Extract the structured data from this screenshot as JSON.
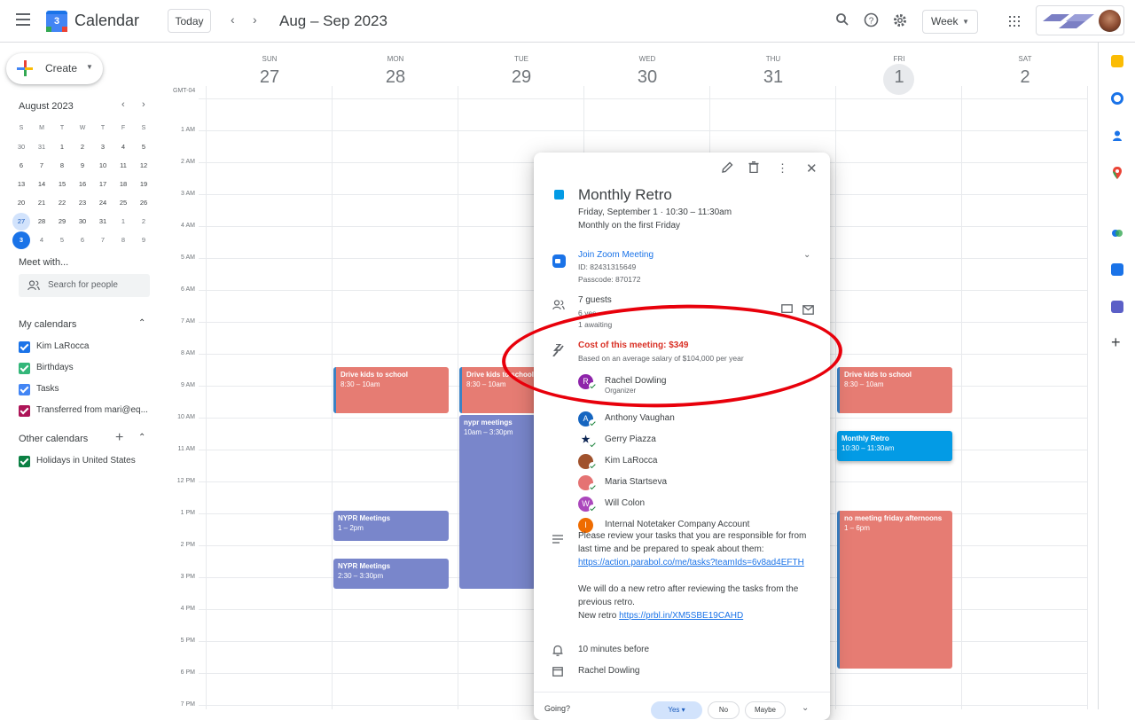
{
  "header": {
    "logo_day": "3",
    "app_title": "Calendar",
    "today_label": "Today",
    "date_range": "Aug – Sep 2023",
    "view_label": "Week"
  },
  "sidebar": {
    "create_label": "Create",
    "mini_month_title": "August 2023",
    "mini_dow": [
      "S",
      "M",
      "T",
      "W",
      "T",
      "F",
      "S"
    ],
    "mini_weeks": [
      [
        "30",
        "31",
        "1",
        "2",
        "3",
        "4",
        "5"
      ],
      [
        "6",
        "7",
        "8",
        "9",
        "10",
        "11",
        "12"
      ],
      [
        "13",
        "14",
        "15",
        "16",
        "17",
        "18",
        "19"
      ],
      [
        "20",
        "21",
        "22",
        "23",
        "24",
        "25",
        "26"
      ],
      [
        "27",
        "28",
        "29",
        "30",
        "31",
        "1",
        "2"
      ],
      [
        "3",
        "4",
        "5",
        "6",
        "7",
        "8",
        "9"
      ]
    ],
    "meet_with": "Meet with...",
    "search_people_placeholder": "Search for people",
    "my_calendars_title": "My calendars",
    "my_calendars": [
      {
        "label": "Kim LaRocca",
        "color": "#1a73e8"
      },
      {
        "label": "Birthdays",
        "color": "#33b679"
      },
      {
        "label": "Tasks",
        "color": "#4285f4"
      },
      {
        "label": "Transferred from mari@eq...",
        "color": "#ad1457"
      }
    ],
    "other_calendars_title": "Other calendars",
    "other_calendars": [
      {
        "label": "Holidays in United States",
        "color": "#0b8043"
      }
    ]
  },
  "calendar": {
    "timezone": "GMT-04",
    "days": [
      {
        "dow": "SUN",
        "num": "27"
      },
      {
        "dow": "MON",
        "num": "28"
      },
      {
        "dow": "TUE",
        "num": "29"
      },
      {
        "dow": "WED",
        "num": "30"
      },
      {
        "dow": "THU",
        "num": "31"
      },
      {
        "dow": "FRI",
        "num": "1"
      },
      {
        "dow": "SAT",
        "num": "2"
      }
    ],
    "hours": [
      "1 AM",
      "2 AM",
      "3 AM",
      "4 AM",
      "5 AM",
      "6 AM",
      "7 AM",
      "8 AM",
      "9 AM",
      "10 AM",
      "11 AM",
      "12 PM",
      "1 PM",
      "2 PM",
      "3 PM",
      "4 PM",
      "5 PM",
      "6 PM",
      "7 PM"
    ],
    "events": [
      {
        "title": "Drive kids to school",
        "time": "8:30 – 10am",
        "day": 1
      },
      {
        "title": "Drive kids to school",
        "time": "8:30 – 10am",
        "day": 2
      },
      {
        "title": "nypr meetings",
        "time": "10am – 3:30pm",
        "day": 2
      },
      {
        "title": "NYPR Meetings",
        "time": "1 – 2pm",
        "day": 1
      },
      {
        "title": "NYPR Meetings",
        "time": "2:30 – 3:30pm",
        "day": 1
      },
      {
        "title": "Drive kids to school",
        "time": "8:30 – 10am",
        "day": 5
      },
      {
        "title": "Monthly Retro",
        "time": "10:30 – 11:30am",
        "day": 5
      },
      {
        "title": "no meeting friday afternoons",
        "time": "1 – 6pm",
        "day": 5
      }
    ]
  },
  "popover": {
    "title": "Monthly Retro",
    "date_line": "Friday, September 1 · 10:30 – 11:30am",
    "recurrence": "Monthly on the first Friday",
    "zoom_link": "Join Zoom Meeting",
    "zoom_id": "ID: 82431315649",
    "zoom_passcode": "Passcode: 870172",
    "guests_count": "7 guests",
    "guests_yes": "6 yes",
    "guests_awaiting": "1 awaiting",
    "cost_title": "Cost of this meeting: $349",
    "cost_sub": "Based on an average salary of $104,000 per year",
    "guests": [
      {
        "initial": "R",
        "name": "Rachel Dowling",
        "role": "Organizer",
        "color": "#8e24aa"
      },
      {
        "initial": "A",
        "name": "Anthony Vaughan",
        "role": "",
        "color": "#1565c0"
      },
      {
        "initial": "",
        "name": "Gerry Piazza",
        "role": "",
        "color": "#ffffff"
      },
      {
        "initial": "",
        "name": "Kim LaRocca",
        "role": "",
        "color": "#a0522d"
      },
      {
        "initial": "",
        "name": "Maria Startseva",
        "role": "",
        "color": "#e57373"
      },
      {
        "initial": "W",
        "name": "Will Colon",
        "role": "",
        "color": "#ab47bc"
      },
      {
        "initial": "I",
        "name": "Internal Notetaker Company Account",
        "role": "",
        "color": "#ef6c00"
      }
    ],
    "description": {
      "p1_text": "Please review your tasks that you are responsible for from last time and be prepared to speak about them: ",
      "p1_link": "https://action.parabol.co/me/tasks?teamIds=6v8ad4EFTH",
      "p2_text": "We will do a new retro after reviewing the tasks from the previous retro.",
      "p3_text": "New retro ",
      "p3_link": "https://prbl.in/XM5SBE19CAHD"
    },
    "reminder": "10 minutes before",
    "calendar_owner": "Rachel Dowling",
    "going_label": "Going?",
    "rsvp_yes": "Yes",
    "rsvp_no": "No",
    "rsvp_maybe": "Maybe"
  },
  "colors": {
    "event_red": "#e67c73",
    "event_purple": "#7986cb",
    "event_blue": "#039be5",
    "annotation_red": "#e8000b"
  }
}
